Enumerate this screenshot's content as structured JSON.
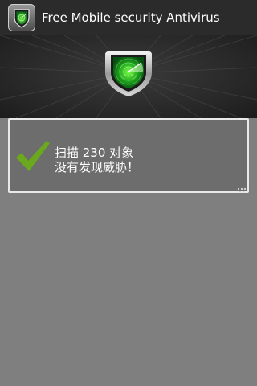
{
  "titlebar": {
    "title": "Free Mobile security Antivirus",
    "icon": "radar-shield-icon"
  },
  "hero": {
    "icon": "radar-shield-icon"
  },
  "result": {
    "scan_text": "扫描 230 对象",
    "status_text": "没有发现威胁！",
    "icon": "checkmark-icon"
  },
  "colors": {
    "titlebar_bg": "#2b2b2b",
    "hero_bg": "#262626",
    "card_bg": "#6d6d6d",
    "card_border": "#e9e9e9",
    "page_bg": "#7f7f7f",
    "accent_green": "#6aa81e",
    "radar_green": "#2fcf2f"
  }
}
